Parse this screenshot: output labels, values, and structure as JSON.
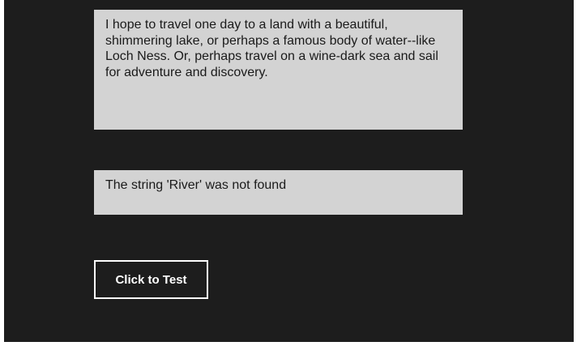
{
  "colors": {
    "app_background": "#1d1d1d",
    "textbox_background": "#d3d3d3",
    "button_border": "#ffffff",
    "button_text": "#ffffff"
  },
  "source_text": {
    "value": "I hope to travel one day to a land with a beautiful, shimmering lake, or perhaps a famous body of water--like Loch Ness. Or, perhaps travel on a wine-dark sea and sail for adventure and discovery."
  },
  "result_text": {
    "value": "The string 'River' was not found"
  },
  "test_button": {
    "label": "Click to Test"
  }
}
